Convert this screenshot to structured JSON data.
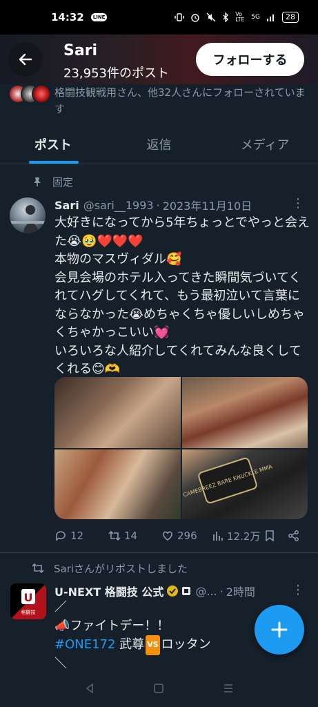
{
  "status_bar": {
    "time": "14:32",
    "line_badge": "LINE",
    "volte": "Vo LTE",
    "network": "5G",
    "battery": "28"
  },
  "header": {
    "name": "Sari",
    "post_count": "23,953件のポスト",
    "follow_label": "フォローする"
  },
  "followers": {
    "text": "格闘技観戦用さん、他32人さんにフォローされています"
  },
  "tabs": [
    {
      "label": "ポスト",
      "active": true
    },
    {
      "label": "返信",
      "active": false
    },
    {
      "label": "メディア",
      "active": false
    }
  ],
  "pinned_label": "固定",
  "tweet": {
    "name": "Sari",
    "handle": "@sari__1993",
    "separator": "·",
    "date": "2023年11月10日",
    "text": "大好きになってから5年ちょっとでやっと会えた😭🥹❤️❤️❤️\n本物のマスヴィダル🥰\n会見会場のホテル入ってきた瞬間気づいてくれてハグしてくれて、もう最初泣いて言葉にならなかった😭めちゃくちゃ優しいしめちゃくちゃかっこいい💓\nいろいろな人紹介してくれてみんな良くしてくれる😊🫶",
    "media_caption": "CAMEBREEZ BARE KNUCKLE MMA",
    "replies": "12",
    "reposts": "14",
    "likes": "296",
    "views": "12.2万"
  },
  "repost": {
    "label": "Sariさんがリポストしました",
    "avatar_top": "U",
    "avatar_bottom": "格闘技",
    "name": "U-NEXT 格闘技 公式",
    "handle": "@...",
    "time": "2時間",
    "line1": "／",
    "line2": "📣ファイトデー！！",
    "hashtag": "#ONE172",
    "line3_a": " 武尊",
    "vs": "VS",
    "line3_b": "ロッタン",
    "line4": "＼"
  },
  "colors": {
    "background": "#15202b",
    "accent": "#1d9bf0",
    "muted": "#8b98a5",
    "text": "#e7e9ea"
  }
}
